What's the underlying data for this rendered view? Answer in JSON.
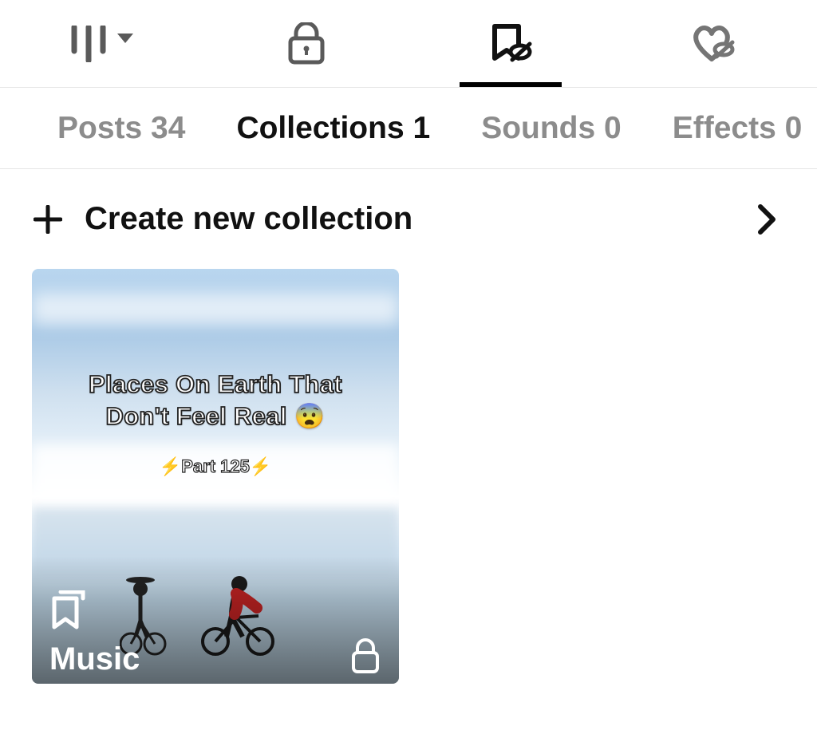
{
  "top_tabs": {
    "grid_icon": "grid-icon",
    "lock_icon": "lock-icon",
    "bookmark_icon": "bookmark-hidden-icon",
    "heart_icon": "heart-hidden-icon",
    "active_index": 2
  },
  "sub_tabs": {
    "items": [
      {
        "label": "Posts",
        "count": "34"
      },
      {
        "label": "Collections",
        "count": "1"
      },
      {
        "label": "Sounds",
        "count": "0"
      },
      {
        "label": "Effects",
        "count": "0"
      }
    ],
    "active_index": 1
  },
  "create": {
    "label": "Create new collection"
  },
  "collection_card": {
    "overlay_line1": "Places On Earth That",
    "overlay_line2": "Don't Feel Real 😨",
    "overlay_sub": "⚡Part 125⚡",
    "title": "Music"
  }
}
